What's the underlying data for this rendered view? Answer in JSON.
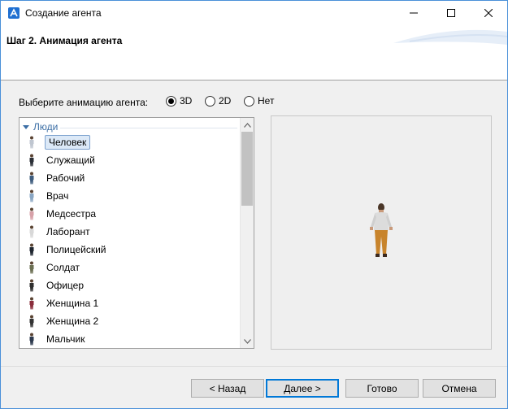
{
  "window": {
    "title": "Создание агента",
    "icon": "anylogic-app-icon"
  },
  "header": {
    "title": "Шаг 2. Анимация агента"
  },
  "animation": {
    "label": "Выберите анимацию агента:",
    "options": [
      {
        "label": "3D",
        "selected": true
      },
      {
        "label": "2D",
        "selected": false
      },
      {
        "label": "Нет",
        "selected": false
      }
    ]
  },
  "list": {
    "group": "Люди",
    "items": [
      {
        "label": "Человек",
        "selected": true,
        "color": "#bfc6d0"
      },
      {
        "label": "Служащий",
        "selected": false,
        "color": "#2b2f36"
      },
      {
        "label": "Рабочий",
        "selected": false,
        "color": "#3f5d7e"
      },
      {
        "label": "Врач",
        "selected": false,
        "color": "#8aa7c4"
      },
      {
        "label": "Медсестра",
        "selected": false,
        "color": "#d7a1a8"
      },
      {
        "label": "Лаборант",
        "selected": false,
        "color": "#d8d8d8"
      },
      {
        "label": "Полицейский",
        "selected": false,
        "color": "#1f2630"
      },
      {
        "label": "Солдат",
        "selected": false,
        "color": "#6b6f52"
      },
      {
        "label": "Офицер",
        "selected": false,
        "color": "#2e2e2e"
      },
      {
        "label": "Женщина 1",
        "selected": false,
        "color": "#8a2d3b"
      },
      {
        "label": "Женщина 2",
        "selected": false,
        "color": "#333333"
      },
      {
        "label": "Мальчик",
        "selected": false,
        "color": "#2d3a4e"
      }
    ]
  },
  "buttons": {
    "back": "< Назад",
    "next": "Далее >",
    "finish": "Готово",
    "cancel": "Отмена"
  }
}
